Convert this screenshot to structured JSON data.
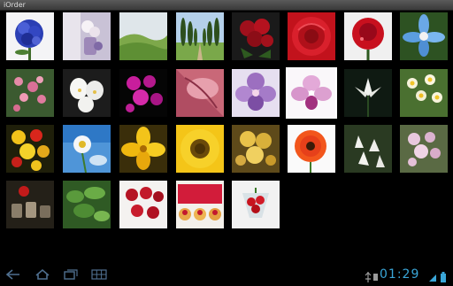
{
  "app": {
    "title": "iOrder"
  },
  "grid": {
    "selected_index": 12,
    "items": [
      {
        "name": "thumb-blue-hydrangea"
      },
      {
        "name": "thumb-white-roses-vase"
      },
      {
        "name": "thumb-green-hills"
      },
      {
        "name": "thumb-cypress-avenue"
      },
      {
        "name": "thumb-red-roses"
      },
      {
        "name": "thumb-red-rose-closeup"
      },
      {
        "name": "thumb-red-rose-dew"
      },
      {
        "name": "thumb-blue-flower"
      },
      {
        "name": "thumb-pink-blossoms"
      },
      {
        "name": "thumb-white-orchids"
      },
      {
        "name": "thumb-magenta-orchids"
      },
      {
        "name": "thumb-pink-petal-closeup"
      },
      {
        "name": "thumb-purple-orchid"
      },
      {
        "name": "thumb-pink-orchid"
      },
      {
        "name": "thumb-white-lily-dark"
      },
      {
        "name": "thumb-daffodils"
      },
      {
        "name": "thumb-yellow-red-flowers"
      },
      {
        "name": "thumb-daisy-sky"
      },
      {
        "name": "thumb-yellow-flower"
      },
      {
        "name": "thumb-sunflower"
      },
      {
        "name": "thumb-yellow-bouquet"
      },
      {
        "name": "thumb-orange-gerbera"
      },
      {
        "name": "thumb-white-lilies"
      },
      {
        "name": "thumb-pink-lilies"
      },
      {
        "name": "thumb-jars-red"
      },
      {
        "name": "thumb-green-plants"
      },
      {
        "name": "thumb-red-apples"
      },
      {
        "name": "thumb-raspberries-tarts"
      },
      {
        "name": "thumb-strawberry-glass"
      }
    ]
  },
  "status": {
    "time": "01:29"
  },
  "colors": {
    "clock": "#3aa6d8",
    "selection": "#ffffff"
  }
}
